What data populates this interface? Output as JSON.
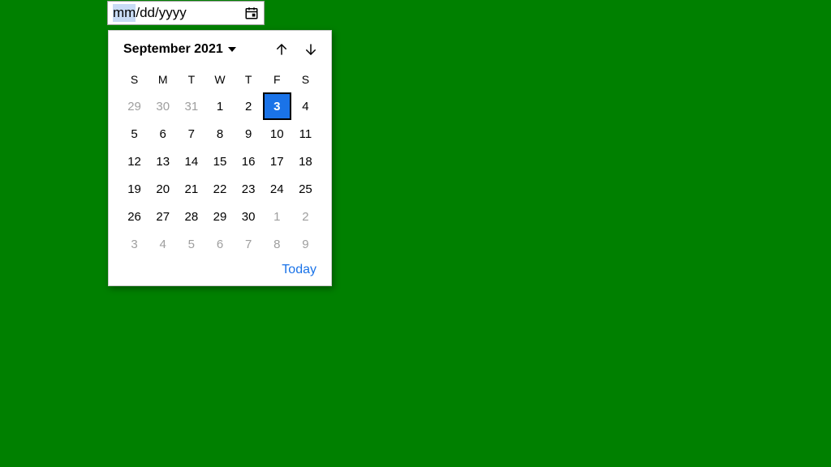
{
  "date_input": {
    "mm": "mm",
    "sep1": "/",
    "dd": "dd",
    "sep2": "/",
    "yyyy": "yyyy"
  },
  "picker": {
    "title": "September 2021",
    "dow": [
      "S",
      "M",
      "T",
      "W",
      "T",
      "F",
      "S"
    ],
    "weeks": [
      [
        {
          "d": "29",
          "other": true
        },
        {
          "d": "30",
          "other": true
        },
        {
          "d": "31",
          "other": true
        },
        {
          "d": "1"
        },
        {
          "d": "2"
        },
        {
          "d": "3",
          "selected": true
        },
        {
          "d": "4"
        }
      ],
      [
        {
          "d": "5"
        },
        {
          "d": "6"
        },
        {
          "d": "7"
        },
        {
          "d": "8"
        },
        {
          "d": "9"
        },
        {
          "d": "10"
        },
        {
          "d": "11"
        }
      ],
      [
        {
          "d": "12"
        },
        {
          "d": "13"
        },
        {
          "d": "14"
        },
        {
          "d": "15"
        },
        {
          "d": "16"
        },
        {
          "d": "17"
        },
        {
          "d": "18"
        }
      ],
      [
        {
          "d": "19"
        },
        {
          "d": "20"
        },
        {
          "d": "21"
        },
        {
          "d": "22"
        },
        {
          "d": "23"
        },
        {
          "d": "24"
        },
        {
          "d": "25"
        }
      ],
      [
        {
          "d": "26"
        },
        {
          "d": "27"
        },
        {
          "d": "28"
        },
        {
          "d": "29"
        },
        {
          "d": "30"
        },
        {
          "d": "1",
          "other": true
        },
        {
          "d": "2",
          "other": true
        }
      ],
      [
        {
          "d": "3",
          "other": true
        },
        {
          "d": "4",
          "other": true
        },
        {
          "d": "5",
          "other": true
        },
        {
          "d": "6",
          "other": true
        },
        {
          "d": "7",
          "other": true
        },
        {
          "d": "8",
          "other": true
        },
        {
          "d": "9",
          "other": true
        }
      ]
    ],
    "today_label": "Today"
  }
}
